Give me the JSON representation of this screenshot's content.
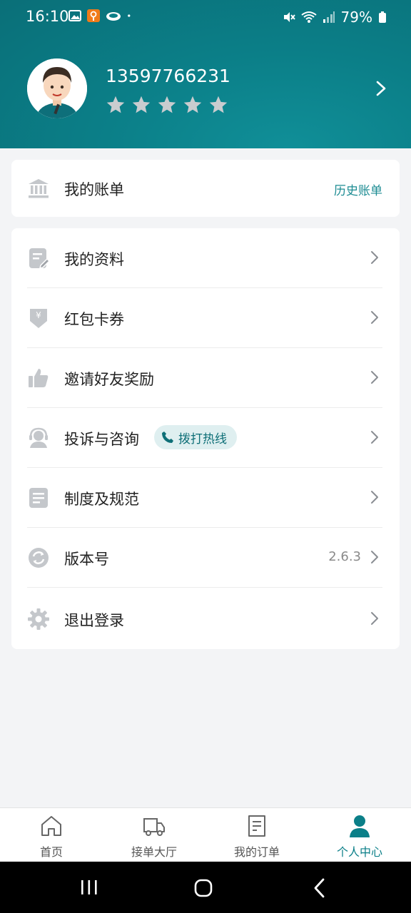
{
  "status_bar": {
    "time": "16:10",
    "battery": "79%"
  },
  "profile": {
    "phone": "13597766231",
    "rating_stars": 5
  },
  "bill": {
    "label": "我的账单",
    "history_link": "历史账单",
    "icon": "bank-icon"
  },
  "menu": {
    "items": [
      {
        "label": "我的资料",
        "icon": "edit-document-icon"
      },
      {
        "label": "红包卡券",
        "icon": "coupon-icon"
      },
      {
        "label": "邀请好友奖励",
        "icon": "thumbs-up-icon"
      },
      {
        "label": "投诉与咨询",
        "icon": "customer-service-icon"
      },
      {
        "label": "制度及规范",
        "icon": "document-icon"
      },
      {
        "label": "版本号",
        "icon": "refresh-icon"
      },
      {
        "label": "退出登录",
        "icon": "gear-icon"
      }
    ],
    "hotline_label": "拨打热线",
    "version_value": "2.6.3"
  },
  "bottom_nav": {
    "items": [
      {
        "label": "首页",
        "icon": "home-icon"
      },
      {
        "label": "接单大厅",
        "icon": "truck-icon"
      },
      {
        "label": "我的订单",
        "icon": "order-icon"
      },
      {
        "label": "个人中心",
        "icon": "user-icon"
      }
    ],
    "active_index": 3
  },
  "colors": {
    "brand": "#0b7f88",
    "accent_text": "#1d8c93",
    "icon_gray": "#c4c7cb"
  }
}
